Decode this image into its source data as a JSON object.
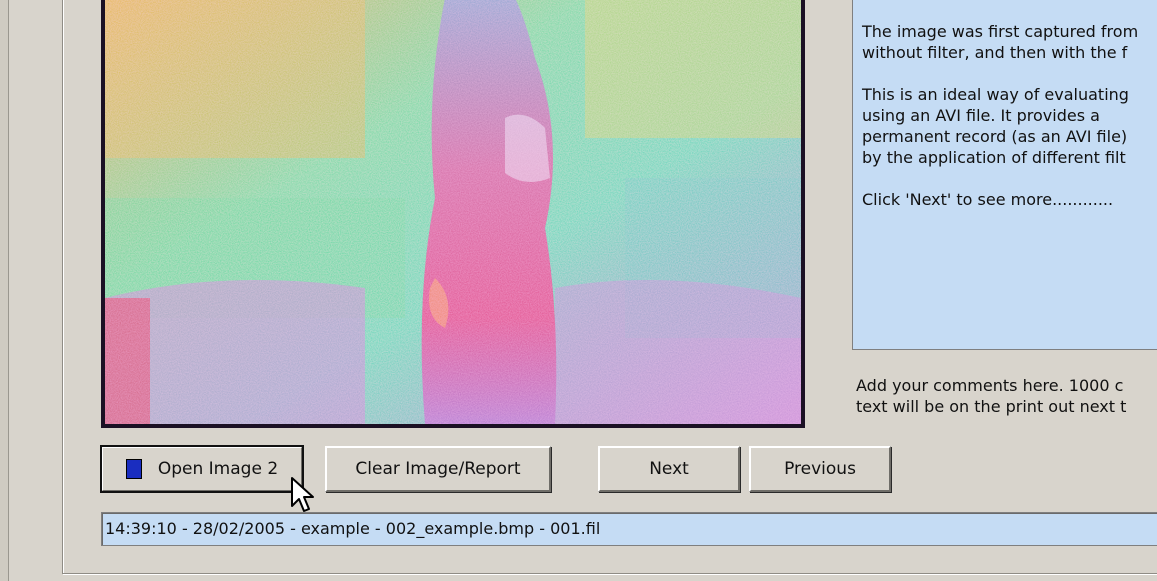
{
  "info_panel": {
    "paragraphs": [
      [
        "The image was first captured from",
        "without filter, and then with the f"
      ],
      [
        "This is an ideal way of evaluating",
        "using an AVI file. It provides a",
        "permanent record (as an AVI file)",
        "by the application of different filt"
      ],
      [
        "Click 'Next' to see more............"
      ]
    ]
  },
  "comments_hint": {
    "line1": "Add your comments here.  1000 c",
    "line2": "text will be on the print out next t"
  },
  "buttons": {
    "open_image": "Open Image 2",
    "clear": "Clear Image/Report",
    "next": "Next",
    "previous": "Previous"
  },
  "status_bar": {
    "text": "14:39:10 - 28/02/2005 - example - 002_example.bmp - 001.fil"
  },
  "colors": {
    "panel_bg": "#c5dcf4",
    "window_bg": "#d8d4cc",
    "swatch": "#1a2dc0"
  },
  "icons": {
    "swatch": "color-swatch-icon",
    "cursor": "mouse-pointer-icon"
  }
}
